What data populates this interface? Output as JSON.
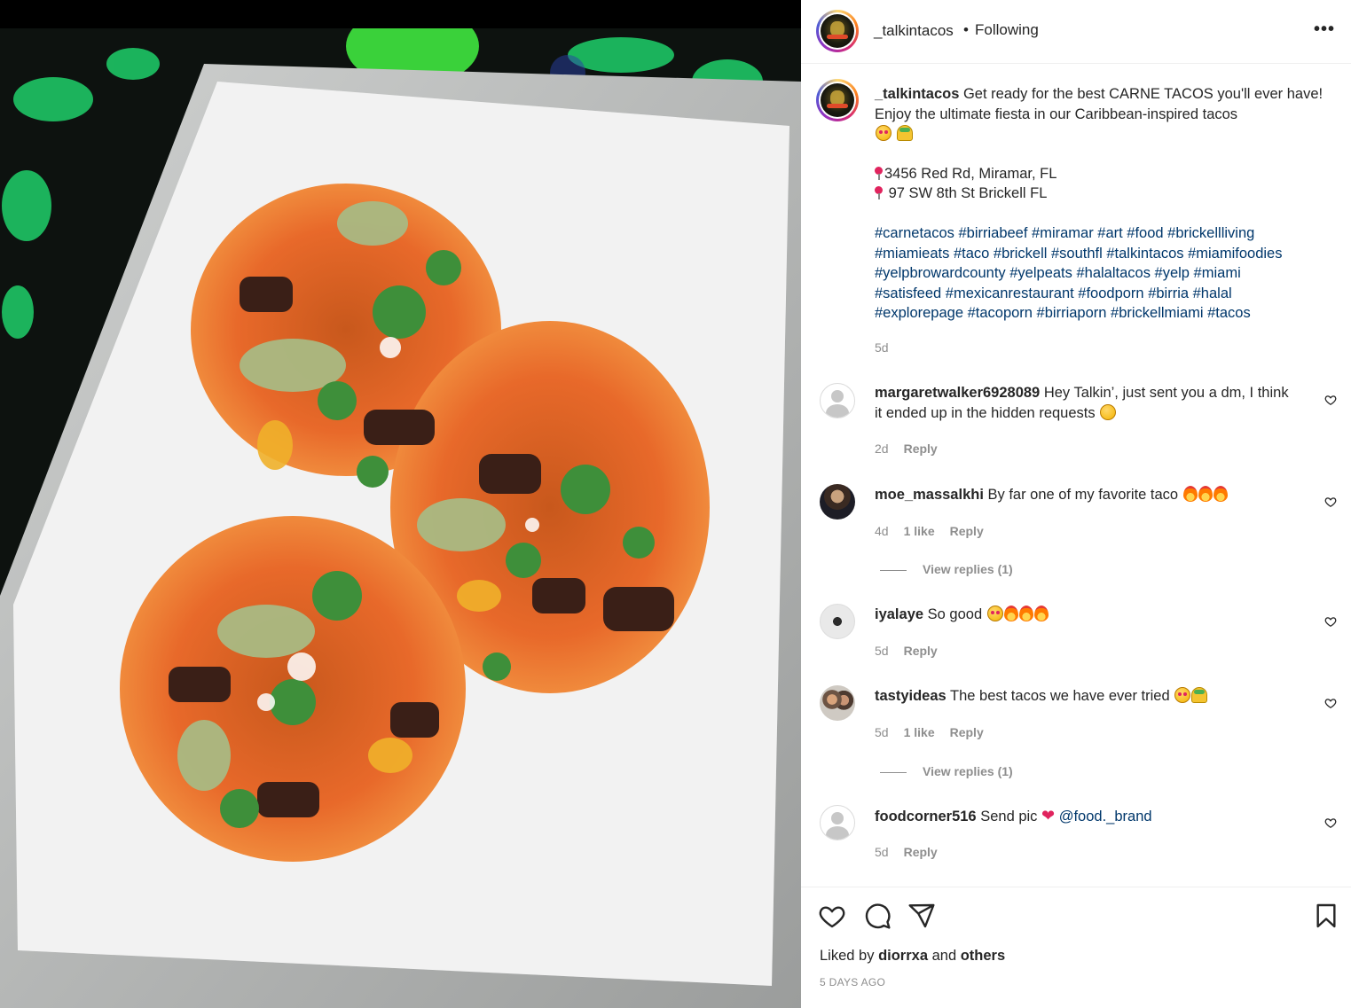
{
  "header": {
    "username": "_talkintacos",
    "separator": "•",
    "follow_status": "Following",
    "more": "•••"
  },
  "caption": {
    "username": "_talkintacos",
    "text": "Get ready for the best CARNE TACOS you'll ever have! Enjoy the ultimate fiesta in our Caribbean-inspired tacos",
    "emojis": [
      "squinting-face-with-tongue",
      "taco"
    ],
    "locations": [
      "3456 Red Rd, Miramar, FL",
      " 97 SW 8th St Brickell FL"
    ],
    "hashtags": [
      "#carnetacos #birriabeef #miramar #art #food #brickellliving",
      "#miamieats #taco #brickell #southfl #talkintacos #miamifoodies",
      "#yelpbrowardcounty #yelpeats #halaltacos #yelp #miami",
      "#satisfeed #mexicanrestaurant #foodporn #birria #halal",
      "#explorepage #tacoporn #birriaporn #brickellmiami #tacos"
    ],
    "time": "5d"
  },
  "comments": [
    {
      "username": "margaretwalker6928089",
      "text_line1": "Hey Talkin’, just sent you a dm, I think",
      "text_line2": "it ended up in the hidden requests",
      "time": "2d",
      "reply": "Reply"
    },
    {
      "username": "moe_massalkhi",
      "text": "By far one of my favorite taco",
      "time": "4d",
      "likes": "1 like",
      "reply": "Reply",
      "view_replies": "View replies (1)"
    },
    {
      "username": "iyalaye",
      "text": "So good",
      "time": "5d",
      "reply": "Reply"
    },
    {
      "username": "tastyideas",
      "text": "The best tacos we have ever tried",
      "time": "5d",
      "likes": "1 like",
      "reply": "Reply",
      "view_replies": "View replies (1)"
    },
    {
      "username": "foodcorner516",
      "text": "Send pic",
      "mention": "@food._brand",
      "time": "5d",
      "reply": "Reply"
    }
  ],
  "footer": {
    "liked_prefix": "Liked by",
    "liked_user": "diorrxa",
    "liked_and": "and",
    "liked_others": "others",
    "posted_ago": "5 DAYS AGO"
  },
  "icons": [
    "heart-icon",
    "comment-icon",
    "share-icon",
    "bookmark-icon"
  ],
  "colors": {
    "link": "#00376b",
    "muted": "#8e8e8e",
    "text": "#262626",
    "tortilla": "#e8692a",
    "cilantro": "#3e8f3a"
  }
}
